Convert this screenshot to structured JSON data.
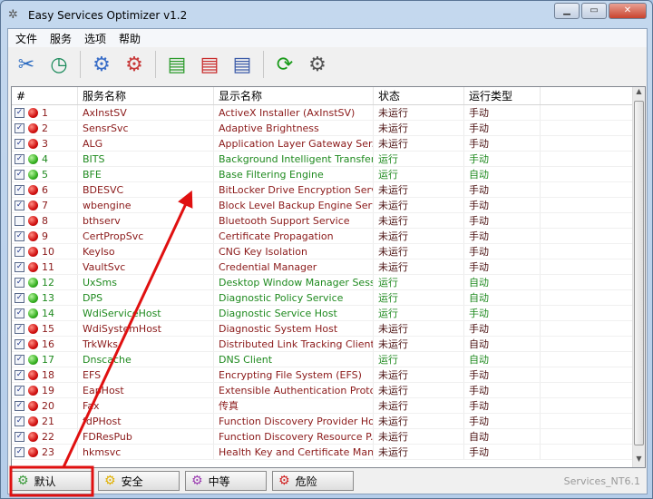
{
  "window": {
    "title": "Easy Services Optimizer v1.2",
    "minimize": "▁",
    "maximize": "▭",
    "close": "✕"
  },
  "menu": [
    "文件",
    "服务",
    "选项",
    "帮助"
  ],
  "toolbar": [
    {
      "icon": "tools-icon",
      "glyph": "✂",
      "color": "#2a6ac0"
    },
    {
      "icon": "clock-icon",
      "glyph": "◷",
      "color": "#1a8a5a"
    },
    {
      "sep": true
    },
    {
      "icon": "gear-start-icon",
      "glyph": "⚙",
      "color": "#3a6ec8"
    },
    {
      "icon": "gear-stop-icon",
      "glyph": "⚙",
      "color": "#c83a3a"
    },
    {
      "sep": true
    },
    {
      "icon": "list-add-icon",
      "glyph": "▤",
      "color": "#2a9a2a"
    },
    {
      "icon": "list-remove-icon",
      "glyph": "▤",
      "color": "#c82a2a"
    },
    {
      "icon": "list-settings-icon",
      "glyph": "▤",
      "color": "#3a5aa8"
    },
    {
      "sep": true
    },
    {
      "icon": "refresh-icon",
      "glyph": "⟳",
      "color": "#1a9a1a"
    },
    {
      "icon": "gears-icon",
      "glyph": "⚙",
      "color": "#555555"
    }
  ],
  "table": {
    "headers": [
      "#",
      "服务名称",
      "显示名称",
      "状态",
      "运行类型",
      ""
    ],
    "rows": [
      {
        "checked": true,
        "running": false,
        "num": "1",
        "name": "AxInstSV",
        "display": "ActiveX Installer (AxInstSV)",
        "status": "未运行",
        "type": "手动"
      },
      {
        "checked": true,
        "running": false,
        "num": "2",
        "name": "SensrSvc",
        "display": "Adaptive Brightness",
        "status": "未运行",
        "type": "手动"
      },
      {
        "checked": true,
        "running": false,
        "num": "3",
        "name": "ALG",
        "display": "Application Layer Gateway Ser...",
        "status": "未运行",
        "type": "手动"
      },
      {
        "checked": true,
        "running": true,
        "num": "4",
        "name": "BITS",
        "display": "Background Intelligent Transfer...",
        "status": "运行",
        "type": "手动"
      },
      {
        "checked": true,
        "running": true,
        "num": "5",
        "name": "BFE",
        "display": "Base Filtering Engine",
        "status": "运行",
        "type": "自动"
      },
      {
        "checked": true,
        "running": false,
        "num": "6",
        "name": "BDESVC",
        "display": "BitLocker Drive Encryption Service",
        "status": "未运行",
        "type": "手动"
      },
      {
        "checked": true,
        "running": false,
        "num": "7",
        "name": "wbengine",
        "display": "Block Level Backup Engine Service",
        "status": "未运行",
        "type": "手动"
      },
      {
        "checked": false,
        "running": false,
        "num": "8",
        "name": "bthserv",
        "display": "Bluetooth Support Service",
        "status": "未运行",
        "type": "手动"
      },
      {
        "checked": true,
        "running": false,
        "num": "9",
        "name": "CertPropSvc",
        "display": "Certificate Propagation",
        "status": "未运行",
        "type": "手动"
      },
      {
        "checked": true,
        "running": false,
        "num": "10",
        "name": "KeyIso",
        "display": "CNG Key Isolation",
        "status": "未运行",
        "type": "手动"
      },
      {
        "checked": true,
        "running": false,
        "num": "11",
        "name": "VaultSvc",
        "display": "Credential Manager",
        "status": "未运行",
        "type": "手动"
      },
      {
        "checked": true,
        "running": true,
        "num": "12",
        "name": "UxSms",
        "display": "Desktop Window Manager Sess...",
        "status": "运行",
        "type": "自动"
      },
      {
        "checked": true,
        "running": true,
        "num": "13",
        "name": "DPS",
        "display": "Diagnostic Policy Service",
        "status": "运行",
        "type": "自动"
      },
      {
        "checked": true,
        "running": true,
        "num": "14",
        "name": "WdiServiceHost",
        "display": "Diagnostic Service Host",
        "status": "运行",
        "type": "手动"
      },
      {
        "checked": true,
        "running": false,
        "num": "15",
        "name": "WdiSystemHost",
        "display": "Diagnostic System Host",
        "status": "未运行",
        "type": "手动"
      },
      {
        "checked": true,
        "running": false,
        "num": "16",
        "name": "TrkWks",
        "display": "Distributed Link Tracking Client",
        "status": "未运行",
        "type": "自动"
      },
      {
        "checked": true,
        "running": true,
        "num": "17",
        "name": "Dnscache",
        "display": "DNS Client",
        "status": "运行",
        "type": "自动"
      },
      {
        "checked": true,
        "running": false,
        "num": "18",
        "name": "EFS",
        "display": "Encrypting File System (EFS)",
        "status": "未运行",
        "type": "手动"
      },
      {
        "checked": true,
        "running": false,
        "num": "19",
        "name": "EapHost",
        "display": "Extensible Authentication Proto...",
        "status": "未运行",
        "type": "手动"
      },
      {
        "checked": true,
        "running": false,
        "num": "20",
        "name": "Fax",
        "display": "传真",
        "status": "未运行",
        "type": "手动"
      },
      {
        "checked": true,
        "running": false,
        "num": "21",
        "name": "fdPHost",
        "display": "Function Discovery Provider Host",
        "status": "未运行",
        "type": "手动"
      },
      {
        "checked": true,
        "running": false,
        "num": "22",
        "name": "FDResPub",
        "display": "Function Discovery Resource P...",
        "status": "未运行",
        "type": "自动"
      },
      {
        "checked": true,
        "running": false,
        "num": "23",
        "name": "hkmsvc",
        "display": "Health Key and Certificate Man...",
        "status": "未运行",
        "type": "手动"
      }
    ]
  },
  "presets": [
    {
      "label": "默认",
      "gear_color": "#3a9a3a"
    },
    {
      "label": "安全",
      "gear_color": "#e0b000"
    },
    {
      "label": "中等",
      "gear_color": "#9a3ab0"
    },
    {
      "label": "危险",
      "gear_color": "#d02020"
    }
  ],
  "status_text": "Services_NT6.1",
  "colors": {
    "running": "#1f8a1f",
    "stopped": "#8b1a1a",
    "annotation": "#e01010"
  }
}
